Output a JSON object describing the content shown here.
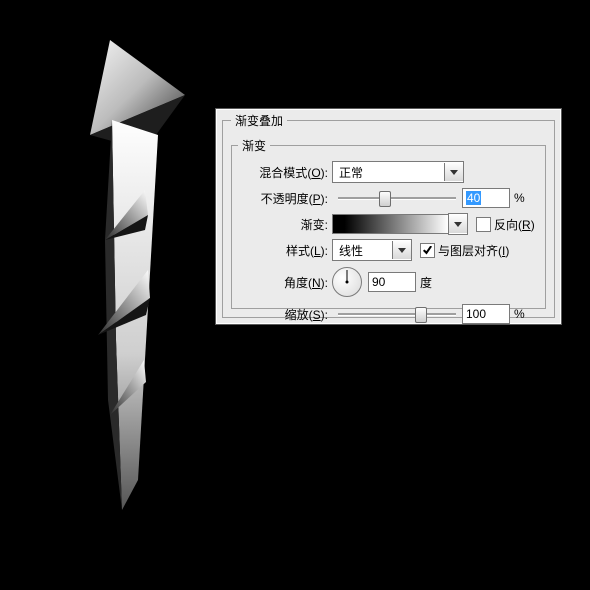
{
  "panel": {
    "title": "渐变叠加",
    "subtitle": "渐变",
    "blend": {
      "label": "混合模式",
      "hotkey": "O",
      "value": "正常"
    },
    "opacity": {
      "label": "不透明度",
      "hotkey": "P",
      "value": "40",
      "unit": "%"
    },
    "gradient": {
      "label": "渐变:",
      "reverse_label": "反向",
      "reverse_hotkey": "R",
      "reverse_checked": false,
      "stops": [
        "#000000",
        "#ffffff"
      ]
    },
    "style": {
      "label": "样式",
      "hotkey": "L",
      "value": "线性",
      "align_label": "与图层对齐",
      "align_hotkey": "I",
      "align_checked": true
    },
    "angle": {
      "label": "角度",
      "hotkey": "N",
      "value": "90",
      "unit": "度"
    },
    "scale": {
      "label": "缩放",
      "hotkey": "S",
      "value": "100",
      "unit": "%"
    }
  }
}
